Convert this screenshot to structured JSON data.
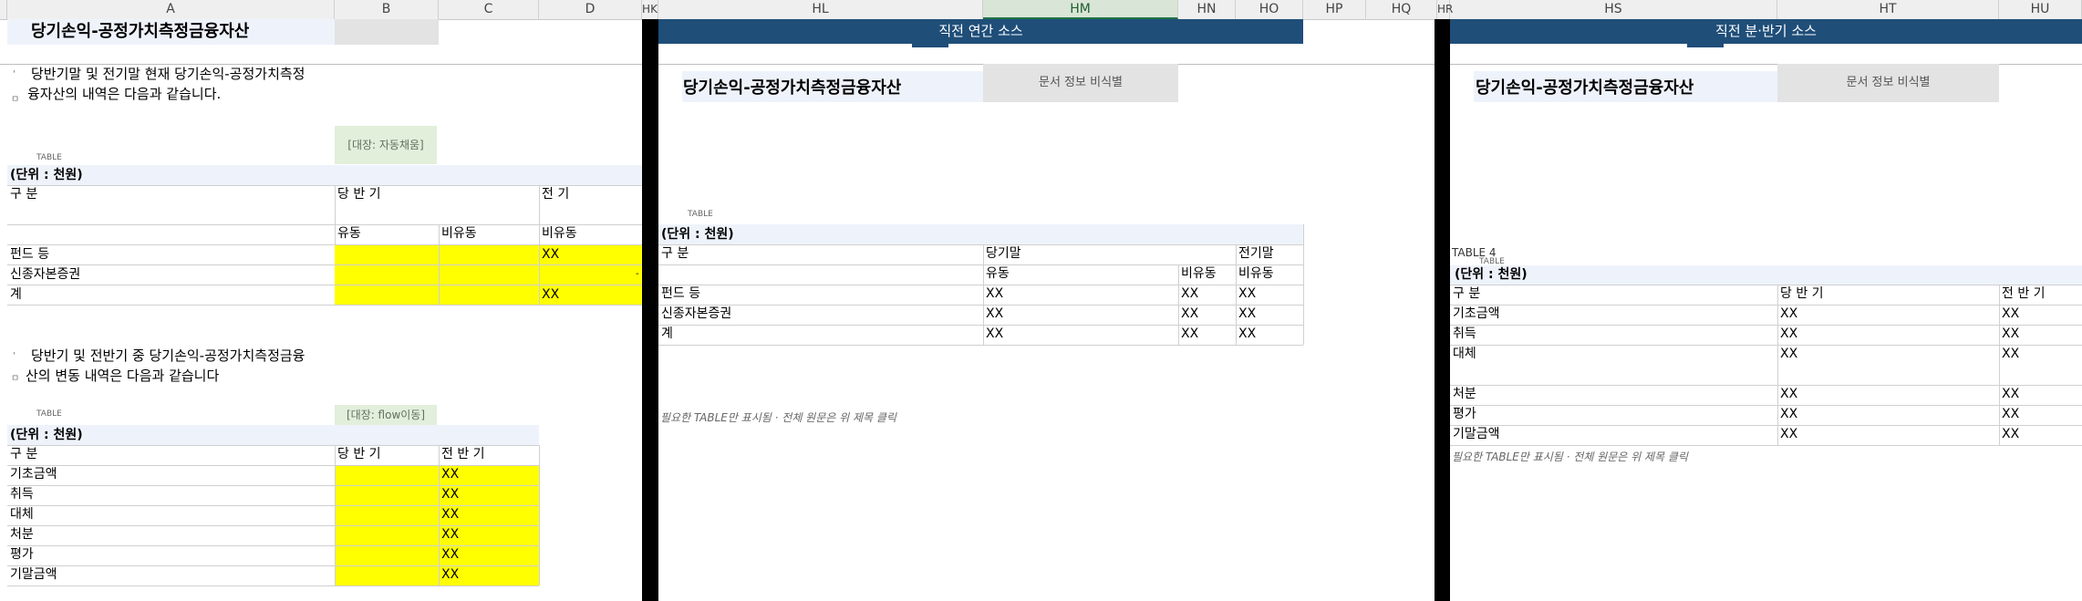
{
  "columns": [
    {
      "id": "row-num",
      "label": ""
    },
    {
      "id": "A",
      "label": "A"
    },
    {
      "id": "B",
      "label": "B"
    },
    {
      "id": "C",
      "label": "C"
    },
    {
      "id": "D",
      "label": "D"
    },
    {
      "id": "HK",
      "label": "HK"
    },
    {
      "id": "HL",
      "label": "HL"
    },
    {
      "id": "HM",
      "label": "HM"
    },
    {
      "id": "HN",
      "label": "HN"
    },
    {
      "id": "HO",
      "label": "HO"
    },
    {
      "id": "HP",
      "label": "HP"
    },
    {
      "id": "HQ",
      "label": "HQ"
    },
    {
      "id": "HR",
      "label": "HR"
    },
    {
      "id": "HS",
      "label": "HS"
    },
    {
      "id": "HT",
      "label": "HT"
    },
    {
      "id": "HU",
      "label": "HU"
    }
  ],
  "left": {
    "title": "당기손익-공정가치측정금융자산",
    "para1_line1": "당반기말 및 전기말 현재 당기손익-공정가치측정",
    "para1_line2": "융자산의 내역은 다음과 같습니다.",
    "para1_mark": "ㅁ",
    "target1": "[대장: 자동채움]",
    "table_label": "TABLE",
    "unit": "(단위 : 천원)",
    "t1": {
      "h_gubun": "구 분",
      "h_curr": "당 반 기",
      "h_prev": "전 기",
      "h_cur_cur": "유동",
      "h_cur_noncur": "비유동",
      "h_prev_noncur": "비유동",
      "rows": [
        {
          "label": "펀드 등",
          "c1": "",
          "c2": "",
          "c3": "XX"
        },
        {
          "label": "신종자본증권",
          "c1": "",
          "c2": "",
          "c3": ""
        },
        {
          "label": "계",
          "c1": "",
          "c2": "",
          "c3": "XX"
        }
      ],
      "dash": "-"
    },
    "para2_line1": "당반기 및 전반기 중 당기손익-공정가치측정금융",
    "para2_line2": "산의 변동 내역은 다음과 같습니다",
    "para2_mark": "ㅁ",
    "target2": "[대장: flow이동]",
    "t2": {
      "h_gubun": "구 분",
      "h_curr": "당 반 기",
      "h_prev": "전 반 기",
      "rows": [
        {
          "label": "기초금액",
          "c1": "",
          "c2": "XX"
        },
        {
          "label": "취득",
          "c1": "",
          "c2": "XX"
        },
        {
          "label": "대체",
          "c1": "",
          "c2": "XX"
        },
        {
          "label": "처분",
          "c1": "",
          "c2": "XX"
        },
        {
          "label": "평가",
          "c1": "",
          "c2": "XX"
        },
        {
          "label": "기말금액",
          "c1": "",
          "c2": "XX"
        }
      ]
    }
  },
  "mid": {
    "banner": "직전 연간 소스",
    "title": "당기손익-공정가치측정금융자산",
    "doc_info": "문서 정보 비식별",
    "table_label": "TABLE",
    "unit": "(단위 : 천원)",
    "h_gubun": "구 분",
    "h_curr": "당기말",
    "h_prev": "전기말",
    "h_cur": "유동",
    "h_noncur": "비유동",
    "h_prev_noncur": "비유동",
    "rows": [
      {
        "label": "펀드 등",
        "c1": "XX",
        "c2": "XX",
        "c3": "XX"
      },
      {
        "label": "신종자본증권",
        "c1": "XX",
        "c2": "XX",
        "c3": "XX"
      },
      {
        "label": "계",
        "c1": "XX",
        "c2": "XX",
        "c3": "XX"
      }
    ],
    "note": "필요한 TABLE만 표시됨 · 전체 원문은 위 제목 클릭"
  },
  "right": {
    "banner": "직전 분·반기 소스",
    "title": "당기손익-공정가치측정금융자산",
    "doc_info": "문서 정보 비식별",
    "table_label": "TABLE",
    "table_label2": "TABLE 4",
    "unit": "(단위 : 천원)",
    "h_gubun": "구 분",
    "h_curr": "당 반 기",
    "h_prev": "전 반 기",
    "rows": [
      {
        "label": "기초금액",
        "c1": "XX",
        "c2": "XX"
      },
      {
        "label": "취득",
        "c1": "XX",
        "c2": "XX"
      },
      {
        "label": "대체",
        "c1": "XX",
        "c2": "XX"
      },
      {
        "label": "처분",
        "c1": "XX",
        "c2": "XX"
      },
      {
        "label": "평가",
        "c1": "XX",
        "c2": "XX"
      },
      {
        "label": "기말금액",
        "c1": "XX",
        "c2": "XX"
      }
    ],
    "note": "필요한 TABLE만 표시됨 · 전체 원문은 위 제목 클릭"
  }
}
